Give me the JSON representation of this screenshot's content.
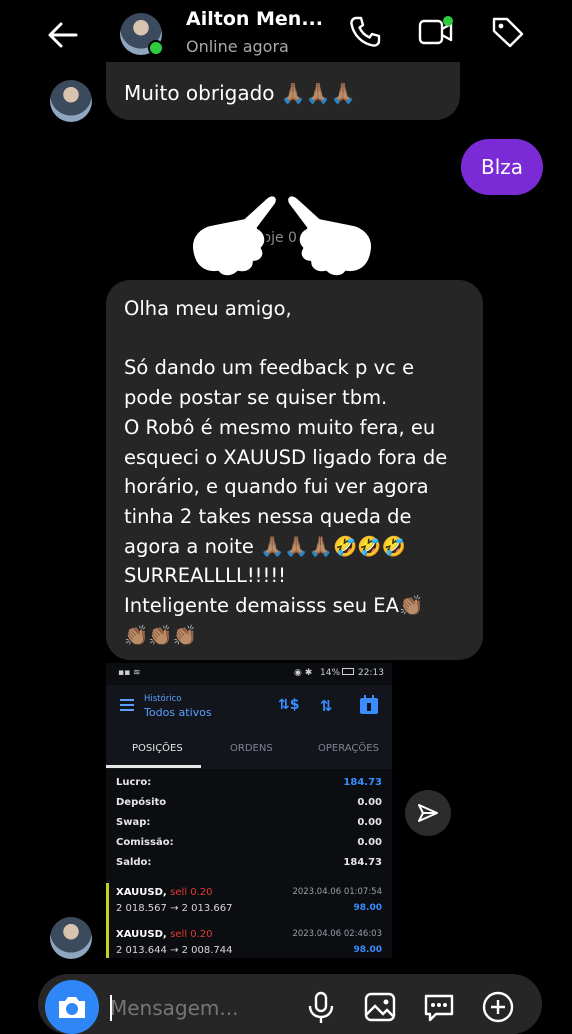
{
  "header": {
    "contact_name": "Ailton Men...",
    "status": "Online agora"
  },
  "messages": {
    "incoming_1": "Muito obrigado 🙏🏽🙏🏽🙏🏽",
    "outgoing_1": "Blza",
    "timestamp": "Hoje 00",
    "incoming_2_lines": [
      "Olha meu amigo,",
      "",
      "Só dando um feedback p vc e",
      "pode postar se quiser tbm.",
      "O Robô é mesmo muito fera, eu",
      "esqueci o XAUUSD ligado fora de",
      "horário, e quando fui ver agora",
      "tinha 2 takes nessa queda de",
      "agora a noite 🙏🏽🙏🏽🙏🏽🤣🤣🤣",
      "SURREALLLL!!!!!",
      "Inteligente demaisss seu EA👏🏽",
      "👏🏽👏🏽👏🏽"
    ]
  },
  "screenshot": {
    "battery": "14%",
    "clock": "22:13",
    "history_label": "Histórico",
    "filter_label": "Todos ativos",
    "tabs": [
      "POSIÇÕES",
      "ORDENS",
      "OPERAÇÕES"
    ],
    "summary": [
      {
        "label": "Lucro:",
        "value": "184.73"
      },
      {
        "label": "Depósito",
        "value": "0.00"
      },
      {
        "label": "Swap:",
        "value": "0.00"
      },
      {
        "label": "Comissão:",
        "value": "0.00"
      },
      {
        "label": "Saldo:",
        "value": "184.73"
      }
    ],
    "deals": [
      {
        "symbol": "XAUUSD,",
        "side": "sell 0.20",
        "prices": "2 018.567 → 2 013.667",
        "datetime": "2023.04.06 01:07:54",
        "profit": "98.00"
      },
      {
        "symbol": "XAUUSD,",
        "side": "sell 0.20",
        "prices": "2 013.644 → 2 008.744",
        "datetime": "2023.04.06 02:46:03",
        "profit": "98.00"
      }
    ]
  },
  "composer": {
    "placeholder": "Mensagem..."
  },
  "colors": {
    "outgoing_bubble": "#7a2bd6",
    "incoming_bubble": "#262626",
    "camera_button": "#2f86f6",
    "online": "#2ecc40",
    "profit_blue": "#3a8cff",
    "sell_red": "#e23b2f"
  }
}
